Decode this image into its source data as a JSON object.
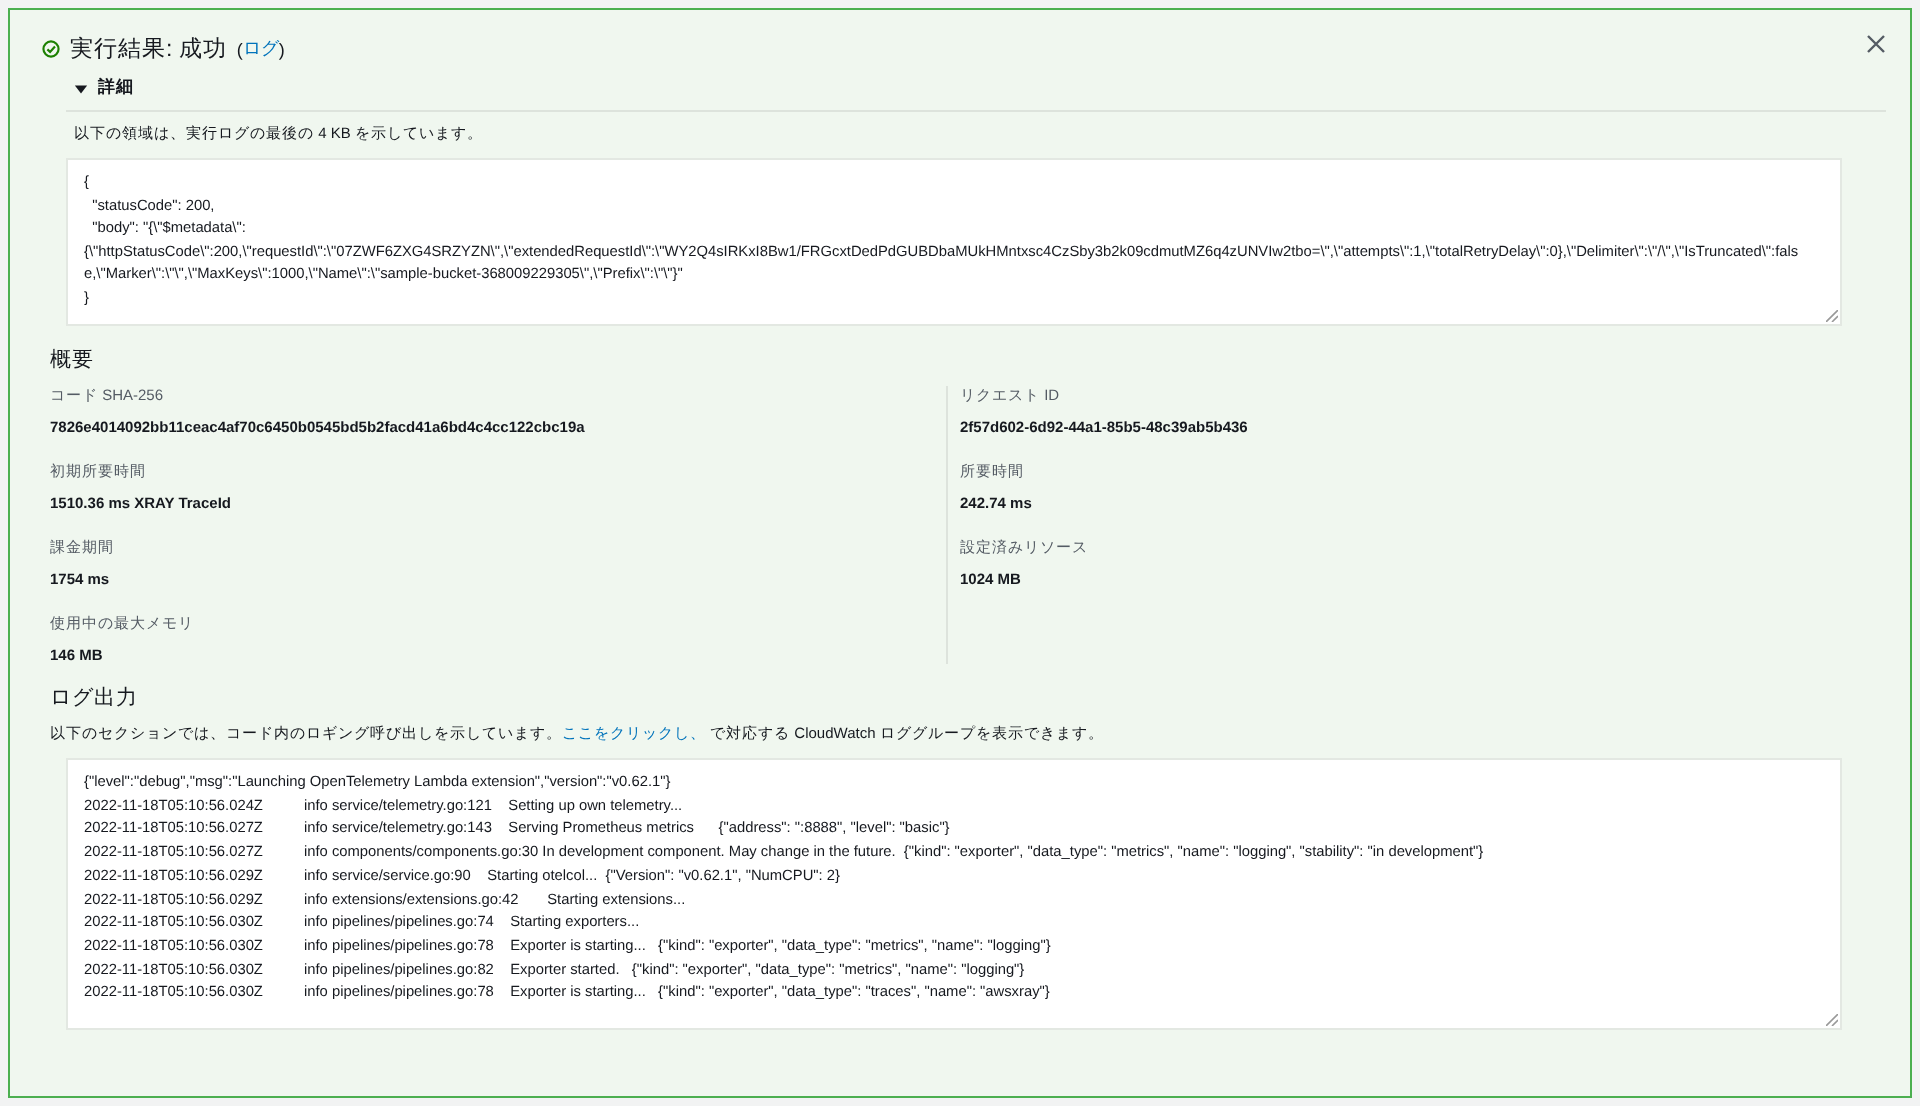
{
  "header": {
    "title": "実行結果: 成功",
    "log_link_open": "(",
    "log_link": "ログ",
    "log_link_close": ")"
  },
  "details": {
    "label": "詳細",
    "expanded": true,
    "note": "以下の領域は、実行ログの最後の 4 KB を示しています。",
    "result_lines": [
      "{",
      "  \"statusCode\": 200,",
      "  \"body\": \"{\\\"$metadata\\\":",
      "{\\\"httpStatusCode\\\":200,\\\"requestId\\\":\\\"07ZWF6ZXG4SRZYZN\\\",\\\"extendedRequestId\\\":\\\"WY2Q4sIRKxI8Bw1/FRGcxtDedPdGUBDbaMUkHMntxsc4CzSby3b2k09cdmutMZ6q4zUNVIw2tbo=\\\",\\\"attempts\\\":1,\\\"totalRetryDelay\\\":0},\\\"Delimiter\\\":\\\"/\\\",\\\"IsTruncated\\\":false,\\\"Marker\\\":\\\"\\\",\\\"MaxKeys\\\":1000,\\\"Name\\\":\\\"sample-bucket-368009229305\\\",\\\"Prefix\\\":\\\"\\\"}\"",
      "}"
    ]
  },
  "summary": {
    "title": "概要",
    "left": [
      {
        "label": "コード SHA-256",
        "value": "7826e4014092bb11ceac4af70c6450b0545bd5b2facd41a6bd4c4cc122cbc19a"
      },
      {
        "label": "初期所要時間",
        "value": "1510.36 ms XRAY TraceId"
      },
      {
        "label": "課金期間",
        "value": "1754 ms"
      },
      {
        "label": "使用中の最大メモリ",
        "value": "146 MB"
      }
    ],
    "right": [
      {
        "label": "リクエスト ID",
        "value": "2f57d602-6d92-44a1-85b5-48c39ab5b436"
      },
      {
        "label": "所要時間",
        "value": "242.74 ms"
      },
      {
        "label": "設定済みリソース",
        "value": "1024 MB"
      }
    ]
  },
  "log_output": {
    "title": "ログ出力",
    "desc_before": "以下のセクションでは、コード内のロギング呼び出しを示しています。",
    "desc_link": "ここをクリックし、",
    "desc_after": " で対応する CloudWatch ロググループを表示できます。",
    "lines": [
      {
        "message": "{\"level\":\"debug\",\"msg\":\"Launching OpenTelemetry Lambda extension\",\"version\":\"v0.62.1\"}"
      },
      {
        "time": "2022-11-18T05:10:56.024Z",
        "message": "info service/telemetry.go:121    Setting up own telemetry..."
      },
      {
        "time": "2022-11-18T05:10:56.027Z",
        "message": "info service/telemetry.go:143    Serving Prometheus metrics      {\"address\": \":8888\", \"level\": \"basic\"}"
      },
      {
        "time": "2022-11-18T05:10:56.027Z",
        "message": "info components/components.go:30 In development component. May change in the future.  {\"kind\": \"exporter\", \"data_type\": \"metrics\", \"name\": \"logging\", \"stability\": \"in development\"}"
      },
      {
        "time": "2022-11-18T05:10:56.029Z",
        "message": "info service/service.go:90    Starting otelcol...  {\"Version\": \"v0.62.1\", \"NumCPU\": 2}"
      },
      {
        "time": "2022-11-18T05:10:56.029Z",
        "message": "info extensions/extensions.go:42       Starting extensions..."
      },
      {
        "time": "2022-11-18T05:10:56.030Z",
        "message": "info pipelines/pipelines.go:74    Starting exporters..."
      },
      {
        "time": "2022-11-18T05:10:56.030Z",
        "message": "info pipelines/pipelines.go:78    Exporter is starting...   {\"kind\": \"exporter\", \"data_type\": \"metrics\", \"name\": \"logging\"}"
      },
      {
        "time": "2022-11-18T05:10:56.030Z",
        "message": "info pipelines/pipelines.go:82    Exporter started.   {\"kind\": \"exporter\", \"data_type\": \"metrics\", \"name\": \"logging\"}"
      },
      {
        "time": "2022-11-18T05:10:56.030Z",
        "message": "info pipelines/pipelines.go:78    Exporter is starting...   {\"kind\": \"exporter\", \"data_type\": \"traces\", \"name\": \"awsxray\"}"
      }
    ]
  }
}
